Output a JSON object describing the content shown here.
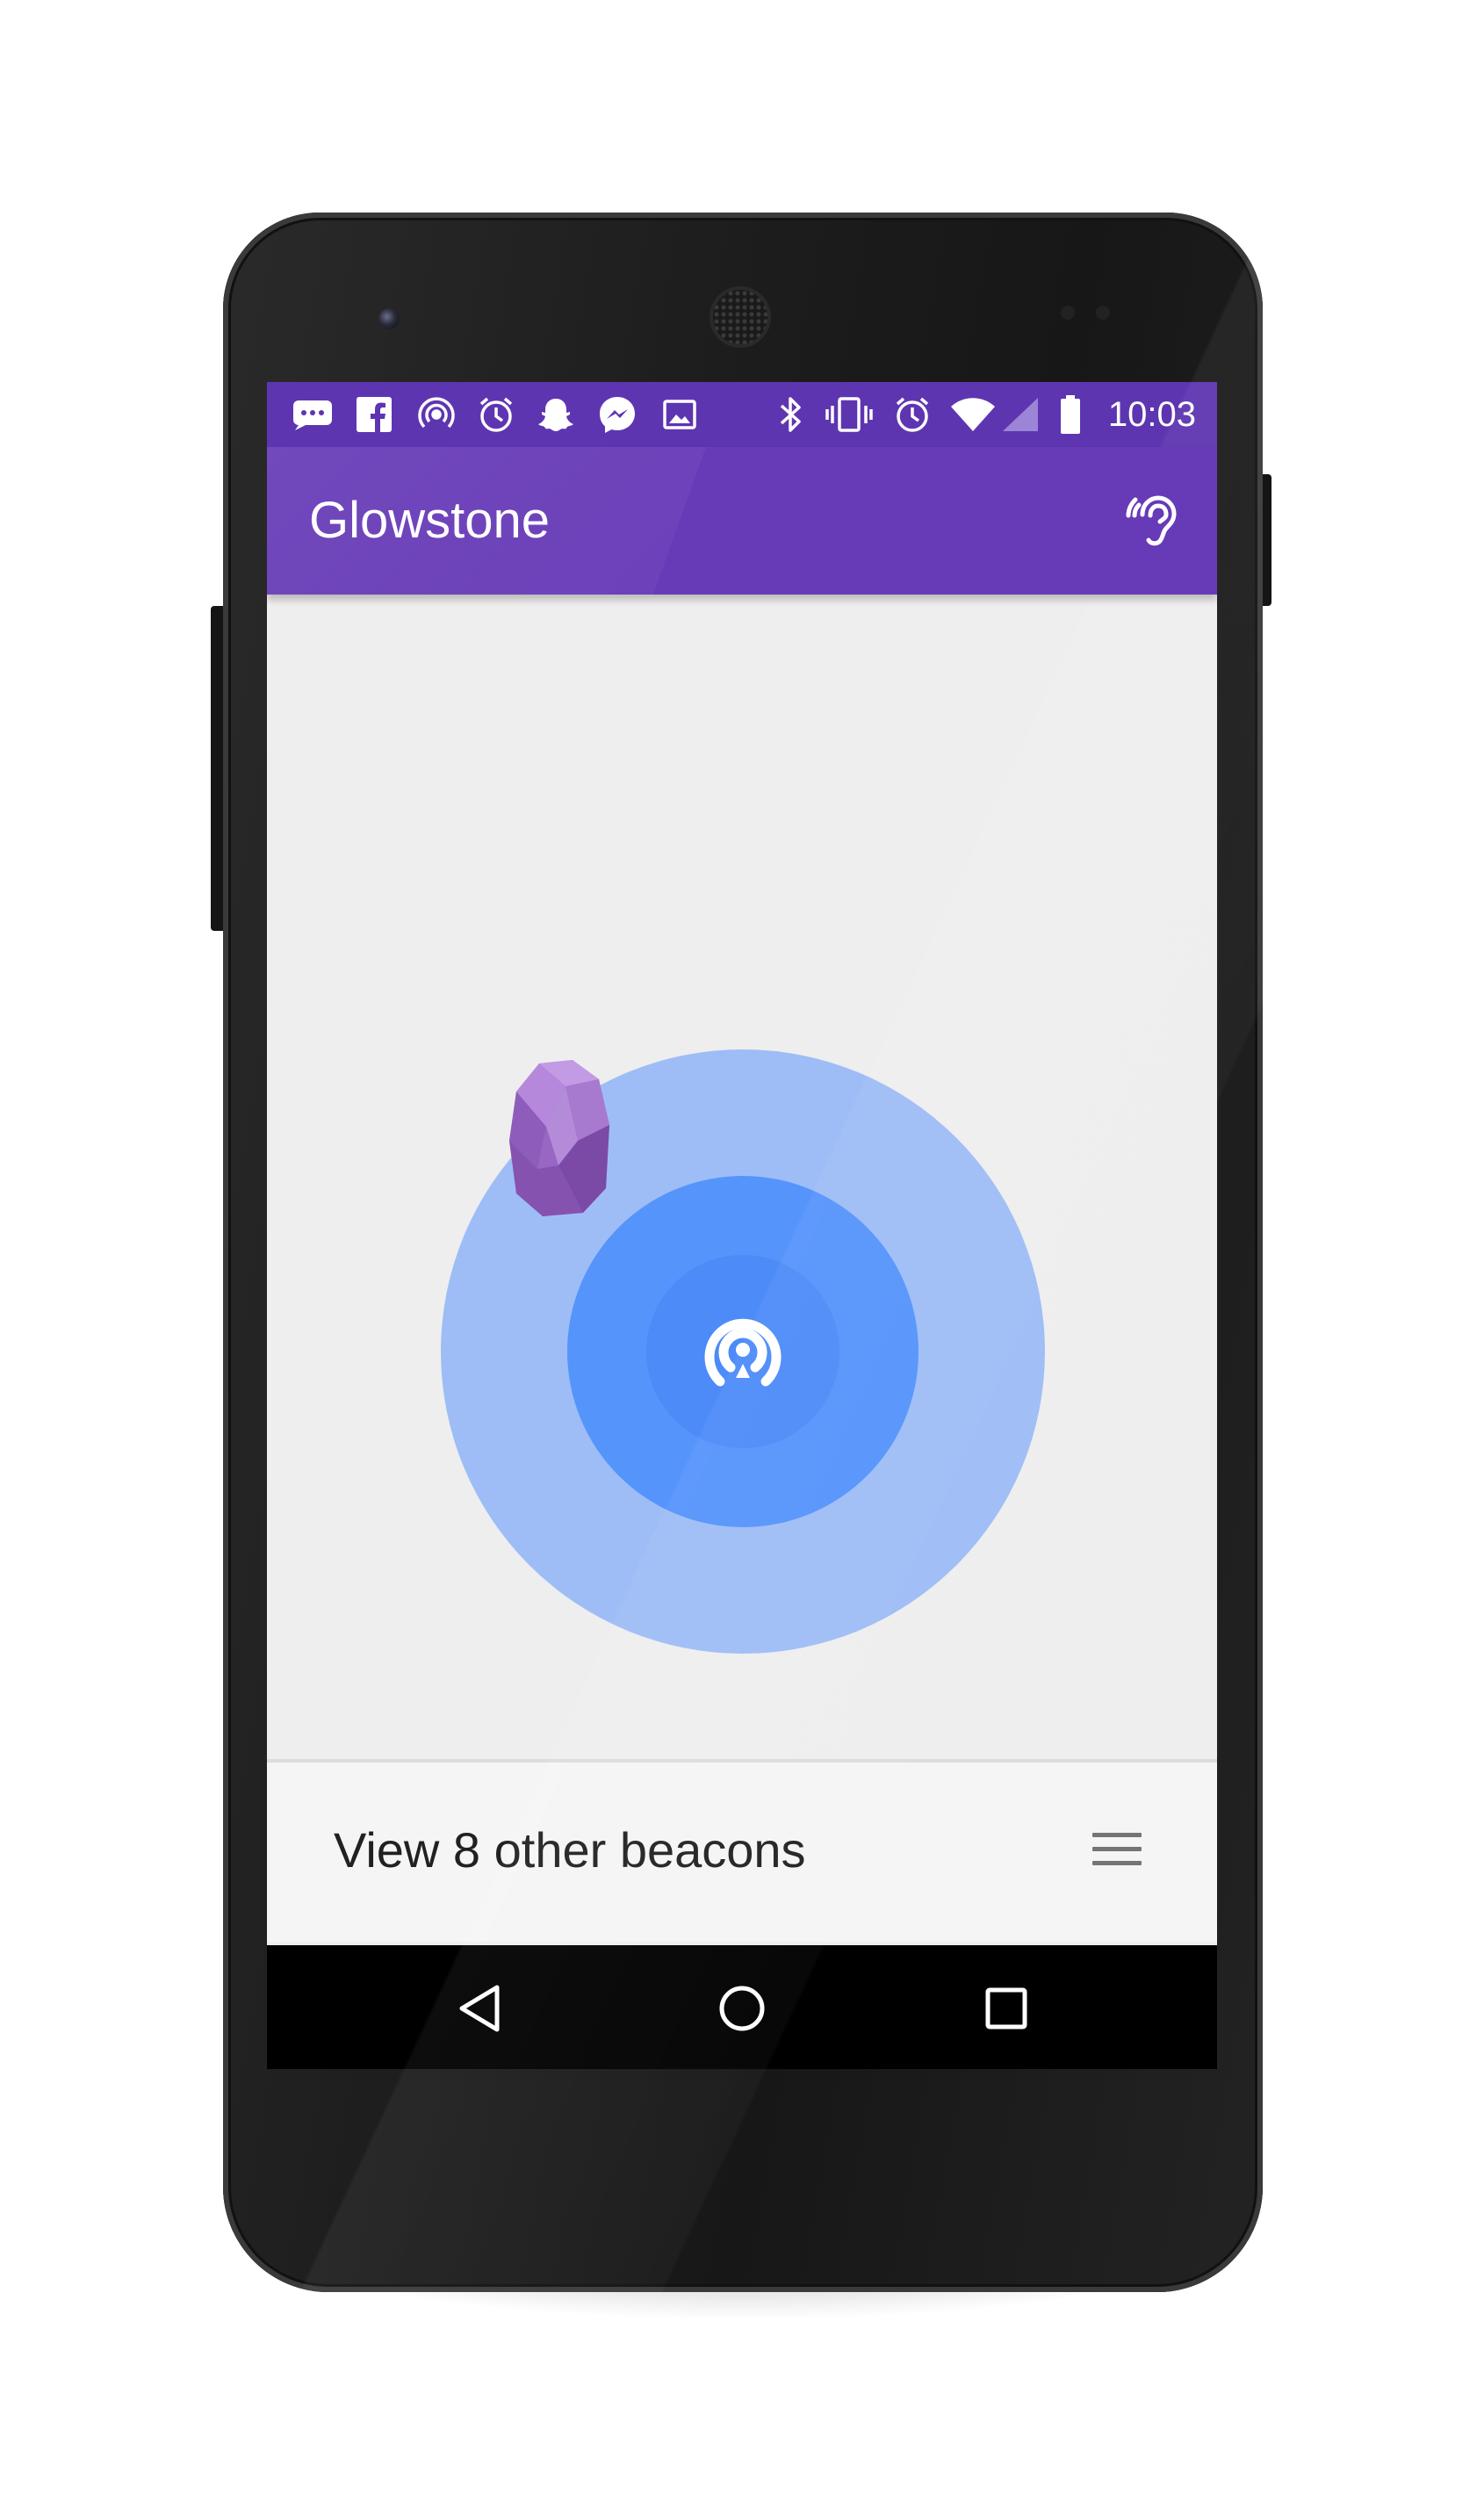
{
  "device": {
    "model": "Nexus 5 style phone"
  },
  "status_bar": {
    "time": "10:03",
    "left_icons": [
      "chat-notification-icon",
      "facebook-icon",
      "beacon-notification-icon",
      "alarm-notification-icon",
      "snapchat-icon",
      "messenger-icon",
      "image-icon"
    ],
    "right_icons": [
      "bluetooth-icon",
      "vibrate-icon",
      "alarm-icon",
      "wifi-icon",
      "cell-signal-icon",
      "battery-icon"
    ]
  },
  "app_bar": {
    "title": "Glowstone",
    "action_icon": "ear-icon"
  },
  "radar": {
    "center_icon": "beacon-broadcast-icon",
    "beacon_icon": "estimote-beacon-icon",
    "colors": {
      "outer": "#9ebdf6",
      "middle": "#5594fb",
      "inner": "#4c8bf8",
      "beacon": "#9b6bc6"
    }
  },
  "bottom_panel": {
    "label": "View 8 other beacons",
    "icon": "list-menu-icon"
  },
  "nav_bar": {
    "buttons": [
      "back-icon",
      "home-icon",
      "recents-icon"
    ]
  },
  "colors": {
    "status_bar": "#5e35b1",
    "app_bar": "#673ab7",
    "background": "#eeeeee"
  }
}
